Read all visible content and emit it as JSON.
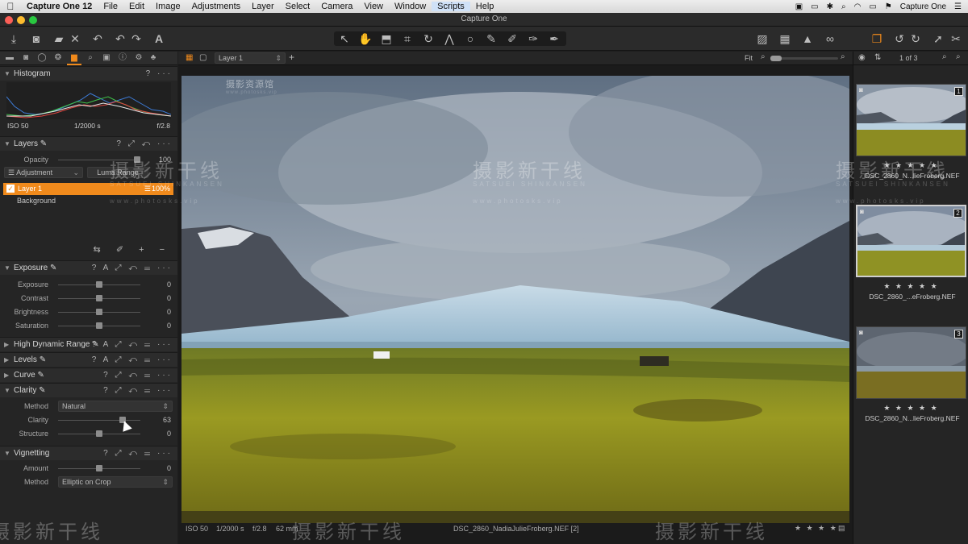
{
  "menubar": {
    "apple": "",
    "items": [
      "Capture One 12",
      "File",
      "Edit",
      "Image",
      "Adjustments",
      "Layer",
      "Select",
      "Camera",
      "View",
      "Window",
      "Scripts",
      "Help"
    ],
    "right_app": "Capture One"
  },
  "window": {
    "title": "Capture One"
  },
  "layer_selector": "Layer 1",
  "zoom": {
    "label": "Fit"
  },
  "browser_counter": "1 of 3",
  "histogram": {
    "title": "Histogram",
    "iso": "ISO 50",
    "shutter": "1/2000 s",
    "aperture": "f/2.8"
  },
  "layers": {
    "title": "Layers",
    "opacity_label": "Opacity",
    "opacity_value": "100",
    "adjustment_btn": "Adjustment",
    "luma_btn": "Luma Range",
    "layer1": "Layer 1",
    "layer1_value": "100%",
    "background": "Background"
  },
  "exposure": {
    "title": "Exposure",
    "rows": [
      {
        "label": "Exposure",
        "value": "0"
      },
      {
        "label": "Contrast",
        "value": "0"
      },
      {
        "label": "Brightness",
        "value": "0"
      },
      {
        "label": "Saturation",
        "value": "0"
      }
    ]
  },
  "collapsed": {
    "hdr": "High Dynamic Range",
    "levels": "Levels",
    "curve": "Curve"
  },
  "clarity": {
    "title": "Clarity",
    "method_label": "Method",
    "method_value": "Natural",
    "clarity_label": "Clarity",
    "clarity_value": "63",
    "structure_label": "Structure",
    "structure_value": "0"
  },
  "vignetting": {
    "title": "Vignetting",
    "amount_label": "Amount",
    "amount_value": "0",
    "method_label": "Method",
    "method_value": "Elliptic on Crop"
  },
  "viewer_bottom": {
    "iso": "ISO 50",
    "shutter": "1/2000 s",
    "aperture": "f/2.8",
    "focal": "62 mm",
    "filename": "DSC_2860_NadiaJulieFroberg.NEF [2]"
  },
  "thumbs": [
    {
      "num": "1",
      "stars": "★ ★ ★ ★ ★",
      "name": "DSC_2860_N...lieFroberg.NEF"
    },
    {
      "num": "2",
      "stars": "★ ★ ★ ★ ★",
      "name": "DSC_2860_...eFroberg.NEF"
    },
    {
      "num": "3",
      "stars": "★ ★ ★ ★ ★",
      "name": "DSC_2860_N...lieFroberg.NEF"
    }
  ],
  "watermark": {
    "main": "摄影新干线",
    "sub": "SATSUEI SHINKANSEN",
    "site": "www.photosks.vip",
    "tiny": "摄影资源馆"
  },
  "colors": {
    "accent": "#f08a1c",
    "panel": "#252525",
    "header": "#2c2c2c"
  }
}
